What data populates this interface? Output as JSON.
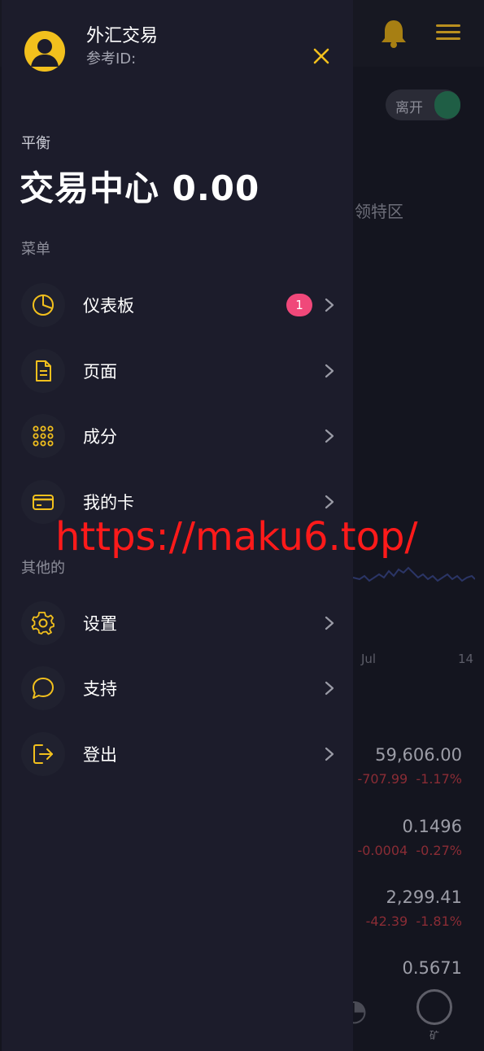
{
  "background": {
    "toggle_label": "离开",
    "section_title": "领特区",
    "chart_axis": [
      "Jul",
      "14"
    ],
    "tickers": [
      {
        "price": "59,606.00",
        "change": "-707.99",
        "change_pct": "-1.17%"
      },
      {
        "price": "0.1496",
        "change": "-0.0004",
        "change_pct": "-0.27%"
      },
      {
        "price": "2,299.41",
        "change": "-42.39",
        "change_pct": "-1.81%"
      },
      {
        "price": "0.5671",
        "change": "",
        "change_pct": ""
      }
    ],
    "bottom_nav_label": "矿"
  },
  "drawer": {
    "app_name": "外汇交易",
    "ref_id_label": "参考ID:",
    "balance_label": "平衡",
    "balance_value": "交易中心 0.00",
    "menu_group_label": "菜单",
    "menu_items": [
      {
        "label": "仪表板",
        "icon": "pie-chart-icon",
        "badge": "1"
      },
      {
        "label": "页面",
        "icon": "document-icon",
        "badge": ""
      },
      {
        "label": "成分",
        "icon": "grid-dots-icon",
        "badge": ""
      },
      {
        "label": "我的卡",
        "icon": "credit-card-icon",
        "badge": ""
      }
    ],
    "other_group_label": "其他的",
    "other_items": [
      {
        "label": "设置",
        "icon": "gear-icon"
      },
      {
        "label": "支持",
        "icon": "chat-bubble-icon"
      },
      {
        "label": "登出",
        "icon": "logout-icon"
      }
    ]
  },
  "watermark": "https://maku6.top/",
  "colors": {
    "accent": "#f2c01d",
    "drawer_bg": "#1c1c2b",
    "badge": "#f0487a",
    "watermark": "#ff1a1a"
  }
}
